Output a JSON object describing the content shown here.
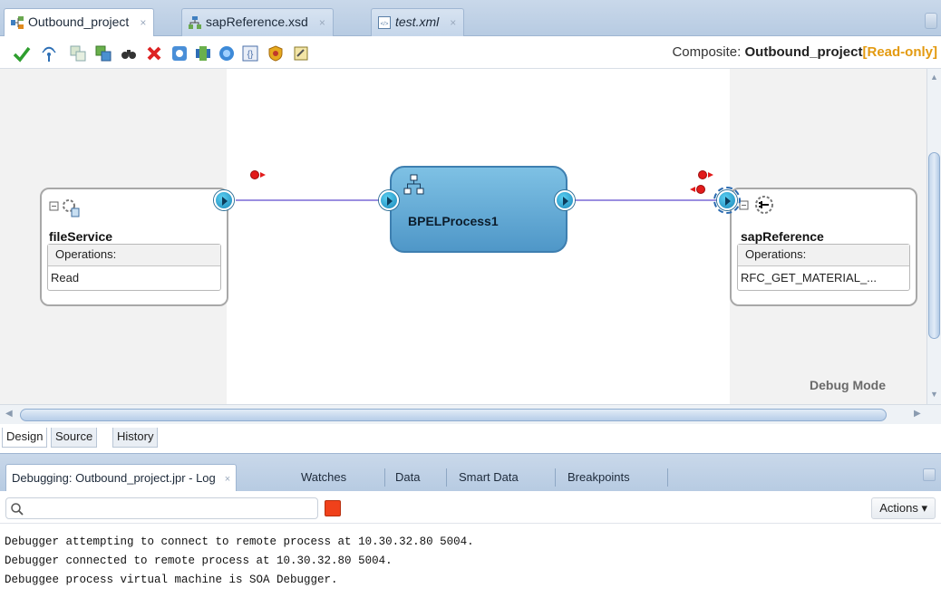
{
  "editor_tabs": [
    {
      "label": "Outbound_project",
      "icon": "composite-icon",
      "active": true
    },
    {
      "label": "sapReference.xsd",
      "icon": "schema-icon",
      "active": false
    },
    {
      "label": "test.xml",
      "icon": "xml-file-icon",
      "active": false
    }
  ],
  "toolbar": {
    "composite_prefix": "Composite:",
    "composite_name": "Outbound_project",
    "composite_state": "[Read-only]",
    "buttons": [
      "validate-icon",
      "wifi-test-icon",
      "copy-icon",
      "layout-icon",
      "find-icon",
      "delete-icon",
      "settings-icon",
      "connect-icon",
      "globe-icon",
      "brackets-icon",
      "shield-icon",
      "edit-icon"
    ]
  },
  "canvas": {
    "file_service": {
      "name": "fileService",
      "ops_header": "Operations:",
      "operation": "Read"
    },
    "bpel": {
      "name": "BPELProcess1"
    },
    "sap_reference": {
      "name": "sapReference",
      "ops_header": "Operations:",
      "operation": "RFC_GET_MATERIAL_..."
    },
    "mode_label": "Debug Mode"
  },
  "editor_view_tabs": [
    "Design",
    "Source",
    "History"
  ],
  "log_panel": {
    "tabs": [
      "Debugging: Outbound_project.jpr - Log",
      "Watches",
      "Data",
      "Smart Data",
      "Breakpoints"
    ],
    "search_placeholder": "",
    "actions_label": "Actions ▾",
    "lines": [
      "Debugger attempting to connect to remote process at 10.30.32.80 5004.",
      "Debugger connected to remote process at 10.30.32.80 5004.",
      "Debuggee process virtual machine is SOA Debugger."
    ]
  },
  "colors": {
    "accent": "#4f97c8",
    "stop": "#f0411b",
    "read_only": "#e39a10",
    "breakpoint": "#e21b1b"
  }
}
